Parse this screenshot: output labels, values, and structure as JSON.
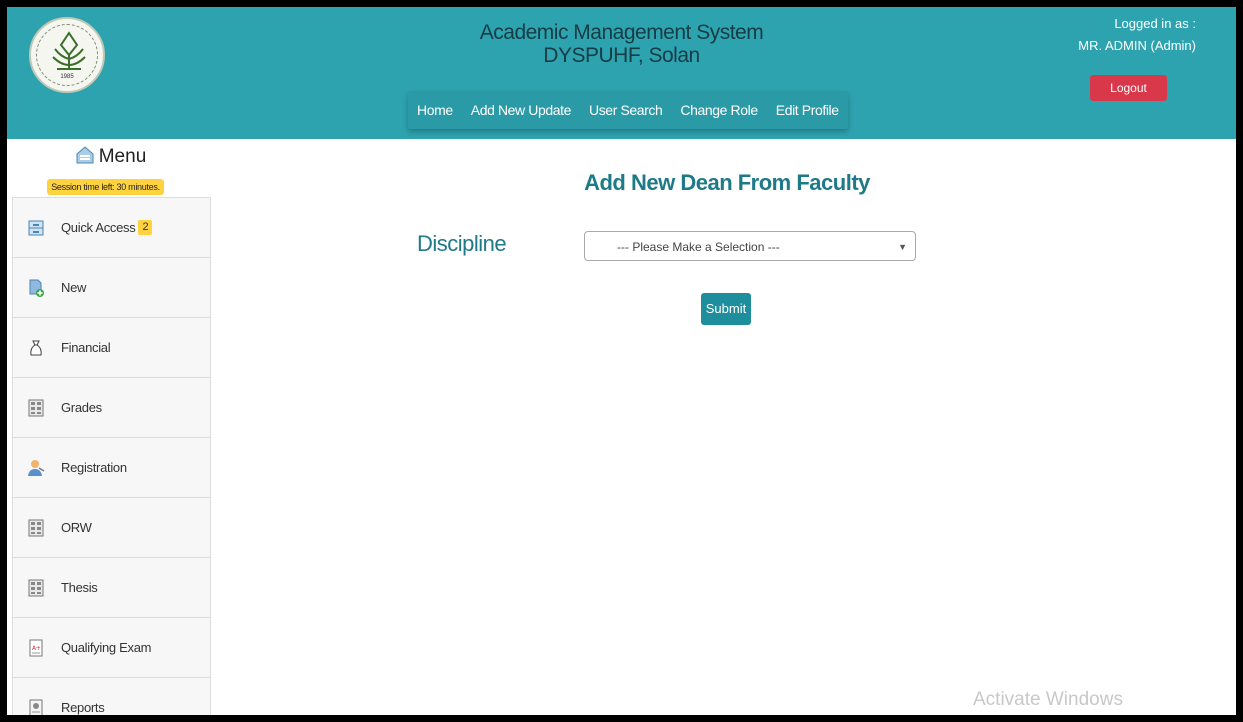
{
  "header": {
    "title_line1": "Academic Management System",
    "title_line2": "DYSPUHF, Solan",
    "nav": [
      "Home",
      "Add New Update",
      "User Search",
      "Change Role",
      "Edit Profile"
    ],
    "logged_in_label": "Logged in as :",
    "user_name": "MR. ADMIN (Admin)",
    "logout_label": "Logout",
    "logo_year": "1985"
  },
  "sidebar": {
    "menu_title": "Menu",
    "session_text": "Session time left: 30 minutes.",
    "items": [
      {
        "label": "Quick Access",
        "badge": "2",
        "icon": "inbox-icon"
      },
      {
        "label": "New",
        "icon": "new-document-icon"
      },
      {
        "label": "Financial",
        "icon": "money-bag-icon"
      },
      {
        "label": "Grades",
        "icon": "grid-icon"
      },
      {
        "label": "Registration",
        "icon": "user-icon"
      },
      {
        "label": "ORW",
        "icon": "grid-icon"
      },
      {
        "label": "Thesis",
        "icon": "grid-icon"
      },
      {
        "label": "Qualifying Exam",
        "icon": "exam-sheet-icon"
      },
      {
        "label": "Reports",
        "icon": "report-icon"
      }
    ]
  },
  "main": {
    "title": "Add New Dean From Faculty",
    "discipline_label": "Discipline",
    "select_value": "--- Please Make a Selection ---",
    "submit_label": "Submit"
  },
  "watermark": "Activate Windows",
  "colors": {
    "header": "#2ea3b0",
    "accent": "#1f7a88",
    "logout": "#d9384a",
    "badge": "#ffd23f"
  }
}
